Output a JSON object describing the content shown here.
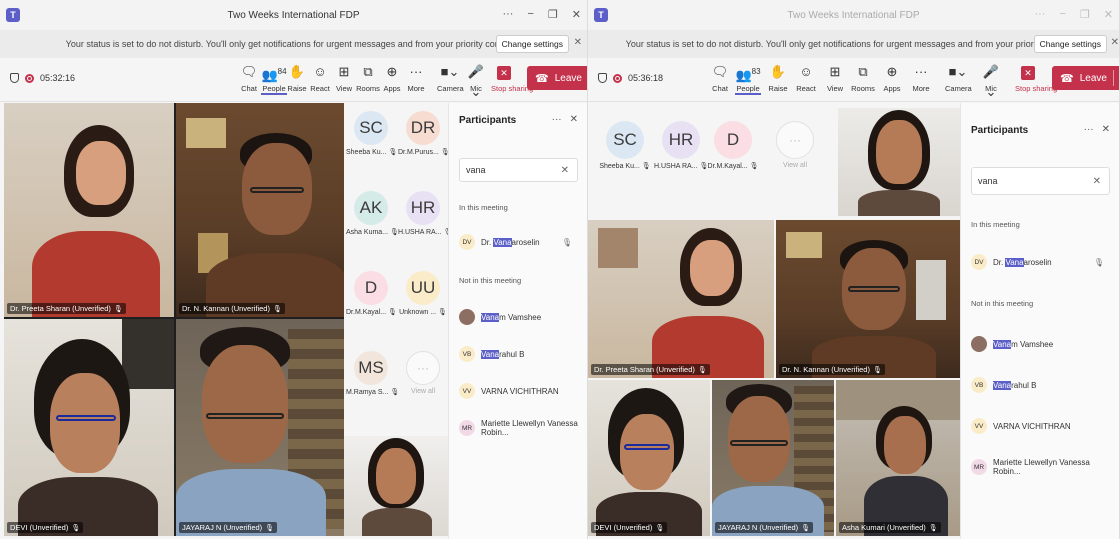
{
  "colors": {
    "accent": "#5b5fc7",
    "leave": "#c4314b",
    "selected_border": "#7b83eb"
  },
  "left": {
    "title": "Two Weeks International FDP",
    "dnd": "Your status is set to do not disturb. You'll only get notifications for urgent messages and from your priority contacts.",
    "change_settings": "Change settings",
    "timer": "05:32:16",
    "toolbar": {
      "chat": "Chat",
      "people": "People",
      "people_count": "84",
      "raise": "Raise",
      "react": "React",
      "view": "View",
      "rooms": "Rooms",
      "apps": "Apps",
      "more": "More",
      "camera": "Camera",
      "mic": "Mic",
      "stop_sharing": "Stop sharing",
      "leave": "Leave"
    },
    "videos": [
      {
        "name": "Dr. Preeta Sharan (Unverified)"
      },
      {
        "name": "Dr. N. Kannan (Unverified)"
      },
      {
        "name": "DEVI (Unverified)"
      },
      {
        "name": "JAYARAJ N (Unverified)"
      },
      {
        "name": ""
      }
    ],
    "avatars": [
      {
        "initials": "SC",
        "caption": "Sheeba Ku...",
        "color": "#dbe7f2"
      },
      {
        "initials": "DR",
        "caption": "Dr.M.Purus...",
        "color": "#f7dcd2"
      },
      {
        "initials": "AK",
        "caption": "Asha Kuma...",
        "color": "#d4ebe8"
      },
      {
        "initials": "HR",
        "caption": "H.USHA RA...",
        "color": "#e7e1f3"
      },
      {
        "initials": "D",
        "caption": "Dr.M.Kayal...",
        "color": "#fbdde4"
      },
      {
        "initials": "UU",
        "caption": "Unknown ...",
        "color": "#fbecc9"
      },
      {
        "initials": "MS",
        "caption": "M.Ramya S...",
        "color": "#f2e6dc"
      }
    ],
    "view_all": "View all",
    "panel": {
      "title": "Participants",
      "search": "vana",
      "in_meeting": "In this meeting",
      "not_in_meeting": "Not in this meeting",
      "in": [
        {
          "initials": "DV",
          "pre": "Dr. ",
          "match": "Vana",
          "post": "aroselin"
        }
      ],
      "out": [
        {
          "initials": "",
          "pre": "",
          "match": "Vana",
          "post": "m Vamshee"
        },
        {
          "initials": "VB",
          "pre": "",
          "match": "Vana",
          "post": "rahul B"
        },
        {
          "initials": "VV",
          "pre": "VARNA VICHITHRAN",
          "match": "",
          "post": ""
        },
        {
          "initials": "MR",
          "pre": "Mariette Llewellyn Vanessa Robin...",
          "match": "",
          "post": ""
        }
      ]
    }
  },
  "right": {
    "title": "Two Weeks International FDP",
    "dnd": "Your status is set to do not disturb. You'll only get notifications for urgent messages and from your priority contacts.",
    "change_settings": "Change settings",
    "timer": "05:36:18",
    "toolbar": {
      "chat": "Chat",
      "people": "People",
      "people_count": "83",
      "raise": "Raise",
      "react": "React",
      "view": "View",
      "rooms": "Rooms",
      "apps": "Apps",
      "more": "More",
      "camera": "Camera",
      "mic": "Mic",
      "stop_sharing": "Stop sharing",
      "leave": "Leave"
    },
    "avatars": [
      {
        "initials": "SC",
        "caption": "Sheeba Ku...",
        "color": "#dbe7f2"
      },
      {
        "initials": "HR",
        "caption": "H.USHA RA...",
        "color": "#e7e1f3"
      },
      {
        "initials": "D",
        "caption": "Dr.M.Kayal...",
        "color": "#fbdde4"
      }
    ],
    "view_all": "View all",
    "videos": [
      {
        "name": ""
      },
      {
        "name": "Dr. Preeta Sharan (Unverified)"
      },
      {
        "name": "Dr. N. Kannan (Unverified)"
      },
      {
        "name": "DEVI (Unverified)"
      },
      {
        "name": "JAYARAJ N (Unverified)"
      },
      {
        "name": "Asha Kumari (Unverified)"
      }
    ],
    "panel": {
      "title": "Participants",
      "search": "vana",
      "in_meeting": "In this meeting",
      "not_in_meeting": "Not in this meeting",
      "in": [
        {
          "initials": "DV",
          "pre": "Dr. ",
          "match": "Vana",
          "post": "aroselin"
        }
      ],
      "out": [
        {
          "initials": "",
          "pre": "",
          "match": "Vana",
          "post": "m Vamshee"
        },
        {
          "initials": "VB",
          "pre": "",
          "match": "Vana",
          "post": "rahul B"
        },
        {
          "initials": "VV",
          "pre": "VARNA VICHITHRAN",
          "match": "",
          "post": ""
        },
        {
          "initials": "MR",
          "pre": "Mariette Llewellyn Vanessa Robin...",
          "match": "",
          "post": ""
        }
      ]
    }
  }
}
